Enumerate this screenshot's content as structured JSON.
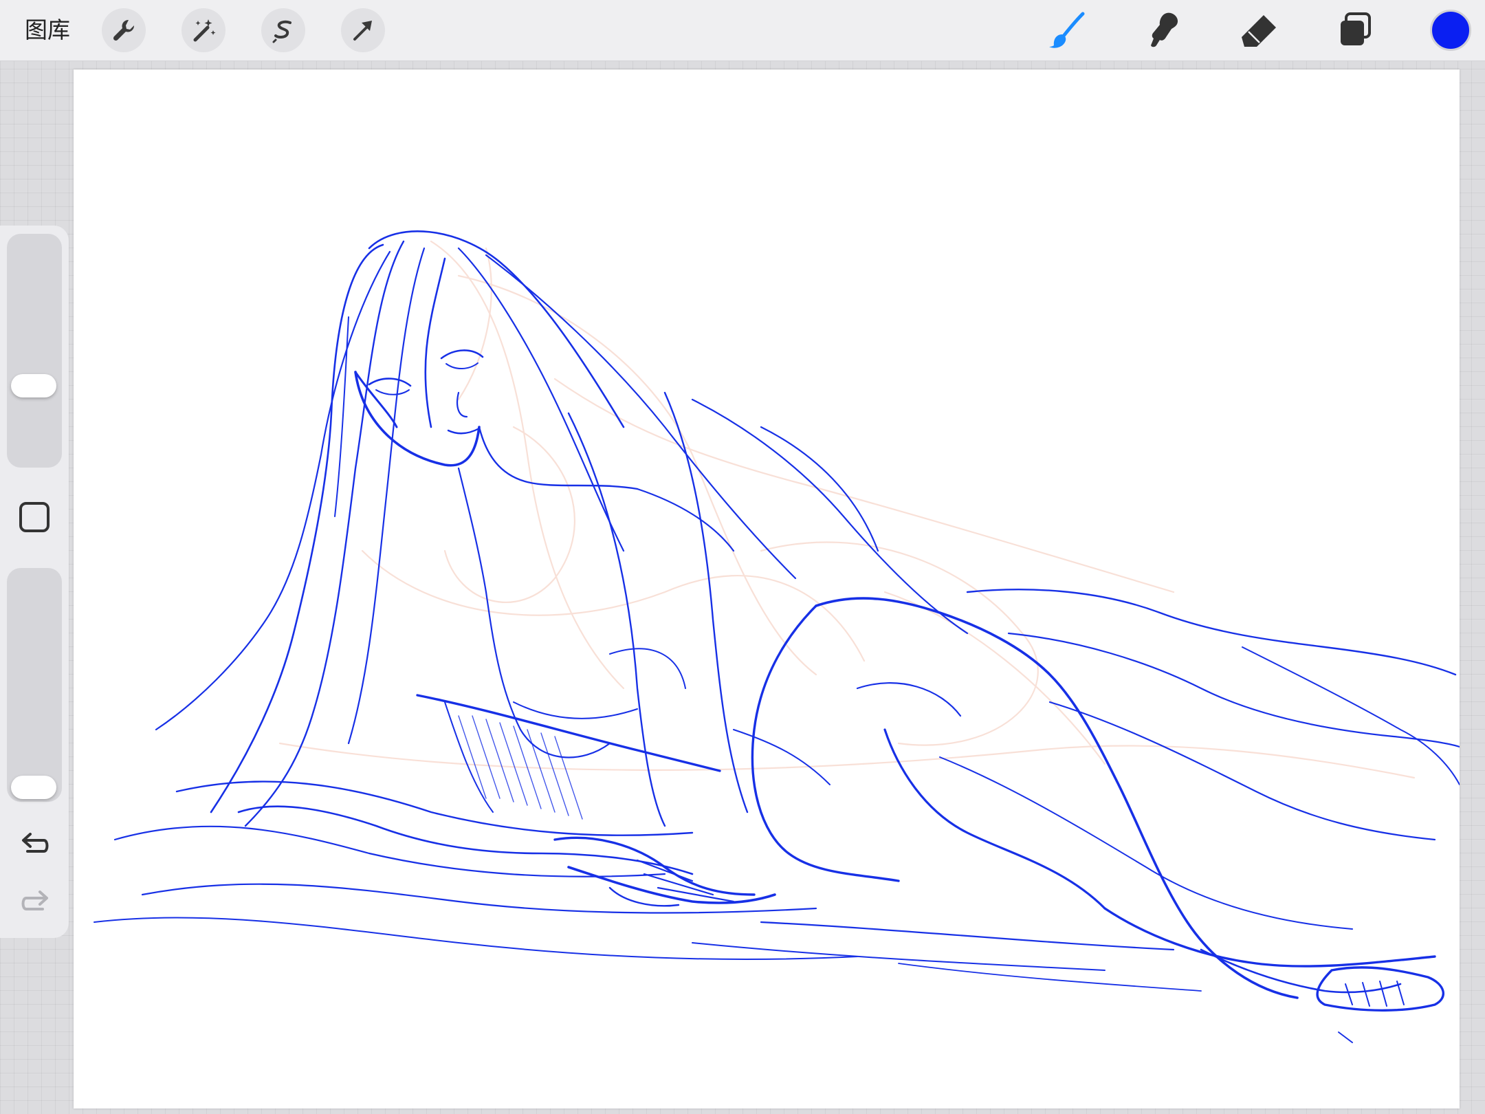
{
  "topbar": {
    "gallery_label": "图库",
    "left_tools": [
      "wrench-icon",
      "magic-wand-icon",
      "selection-icon",
      "transform-arrow-icon"
    ],
    "right_tools": [
      "brush-icon",
      "smudge-icon",
      "eraser-icon",
      "layers-icon"
    ],
    "active_tool": "brush",
    "accent_color": "#1a8cff",
    "current_color": "#0a1ff2"
  },
  "sidebar": {
    "brush_size_level": 0.33,
    "opacity_level": 0.0
  },
  "canvas": {
    "background": "#ffffff",
    "sketch_color": "#1730e6",
    "underlay_color": "#f4c7b7"
  }
}
